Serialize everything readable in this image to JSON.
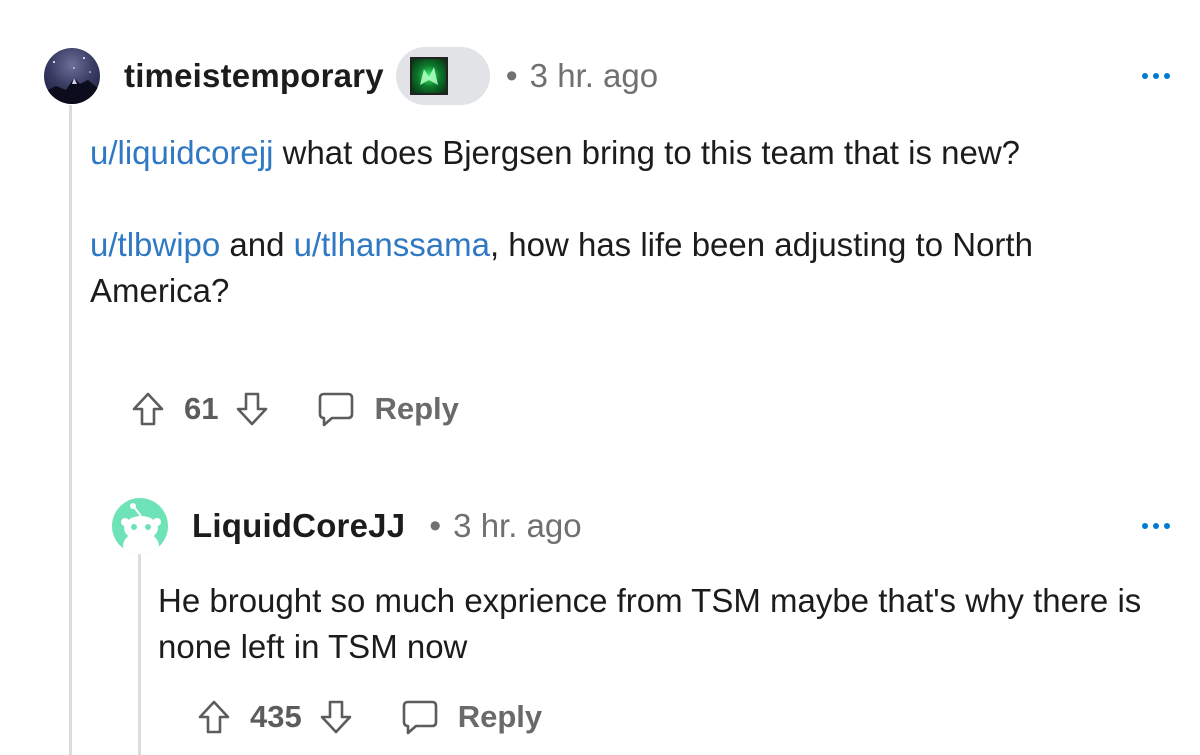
{
  "comments": [
    {
      "author": "timeistemporary",
      "separator": "•",
      "time": "3 hr. ago",
      "body": {
        "para1_link1": "u/liquidcorejj",
        "para1_text": " what does Bjergsen bring to this team that is new?",
        "para2_link1": "u/tlbwipo",
        "para2_text1": " and ",
        "para2_link2": "u/tlhanssama",
        "para2_text2": ", how has life been adjusting to North America?"
      },
      "score": "61",
      "reply_label": "Reply"
    },
    {
      "author": "LiquidCoreJJ",
      "separator": "•",
      "time": "3 hr. ago",
      "body": {
        "para1_text": "He brought so much exprience from TSM maybe that's why there is none left in TSM now"
      },
      "score": "435",
      "reply_label": "Reply"
    }
  ],
  "icons": {
    "upvote": "arrow-up-icon",
    "downvote": "arrow-down-icon",
    "reply": "speech-bubble-icon",
    "more": "ellipsis-icon"
  },
  "colors": {
    "link": "#2f78c4",
    "more_dots": "#0079d3",
    "snoo_avatar_bg": "#6fe3b8",
    "flair_bg": "#e1e3e6"
  }
}
